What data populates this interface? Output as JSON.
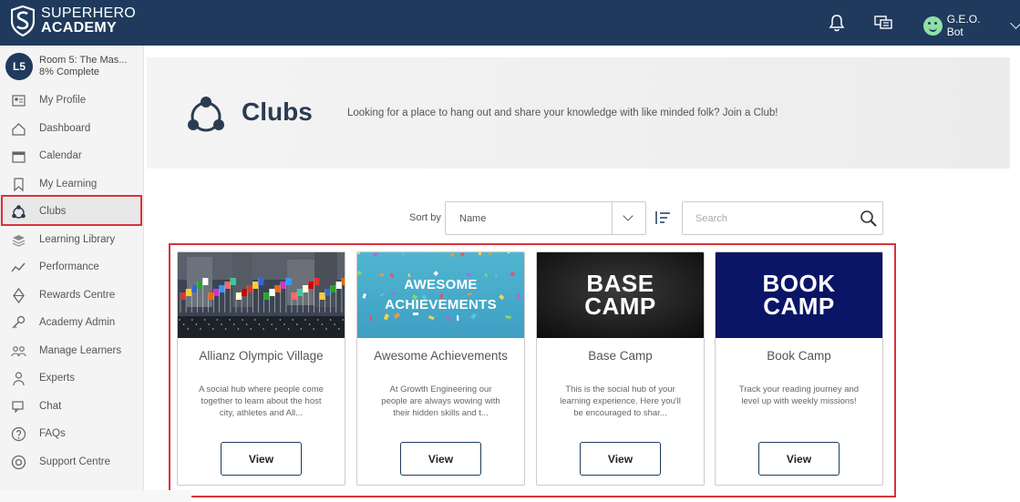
{
  "header": {
    "logo_line1": "SUPERHERO",
    "logo_line2": "ACADEMY",
    "user_name": "G.E.O. Bot"
  },
  "sidebar": {
    "room_badge": "L5",
    "room_title": "Room 5: The Mas...",
    "room_progress": "8% Complete",
    "items": [
      {
        "label": "My Profile",
        "icon": "profile-icon"
      },
      {
        "label": "Dashboard",
        "icon": "home-icon"
      },
      {
        "label": "Calendar",
        "icon": "calendar-icon"
      },
      {
        "label": "My Learning",
        "icon": "bookmark-icon"
      },
      {
        "label": "Clubs",
        "icon": "clubs-icon"
      },
      {
        "label": "Learning Library",
        "icon": "books-icon"
      },
      {
        "label": "Performance",
        "icon": "chart-icon"
      },
      {
        "label": "Rewards Centre",
        "icon": "diamond-icon"
      },
      {
        "label": "Academy Admin",
        "icon": "key-icon"
      },
      {
        "label": "Manage Learners",
        "icon": "group-icon"
      },
      {
        "label": "Experts",
        "icon": "expert-icon"
      },
      {
        "label": "Chat",
        "icon": "chat-icon"
      },
      {
        "label": "FAQs",
        "icon": "question-icon"
      },
      {
        "label": "Support Centre",
        "icon": "lifebuoy-icon"
      }
    ],
    "active_index": 4
  },
  "hero": {
    "title": "Clubs",
    "subtitle": "Looking for a place to hang out and share your knowledge with like minded folk? Join a Club!"
  },
  "controls": {
    "sort_label": "Sort by",
    "sort_value": "Name",
    "search_placeholder": "Search"
  },
  "cards": [
    {
      "title": "Allianz Olympic Village",
      "description": "A social hub where people come together to learn about the host city, athletes and All...",
      "button": "View",
      "image": "flags-photo"
    },
    {
      "title": "Awesome Achievements",
      "description": "At Growth Engineering our people are always wowing with their hidden skills and t...",
      "button": "View",
      "image": "confetti-banner",
      "image_text": "AWESOME ACHIEVEMENTS"
    },
    {
      "title": "Base Camp",
      "description": "This is the social hub of your learning experience. Here you'll be encouraged to shar...",
      "button": "View",
      "image": "dark-banner",
      "image_text": "BASE CAMP"
    },
    {
      "title": "Book Camp",
      "description": "Track your reading journey and level up with weekly missions!",
      "button": "View",
      "image": "navy-banner",
      "image_text": "BOOK CAMP"
    }
  ],
  "colors": {
    "navy": "#1f3a5c",
    "highlight_red": "#d9323a"
  }
}
